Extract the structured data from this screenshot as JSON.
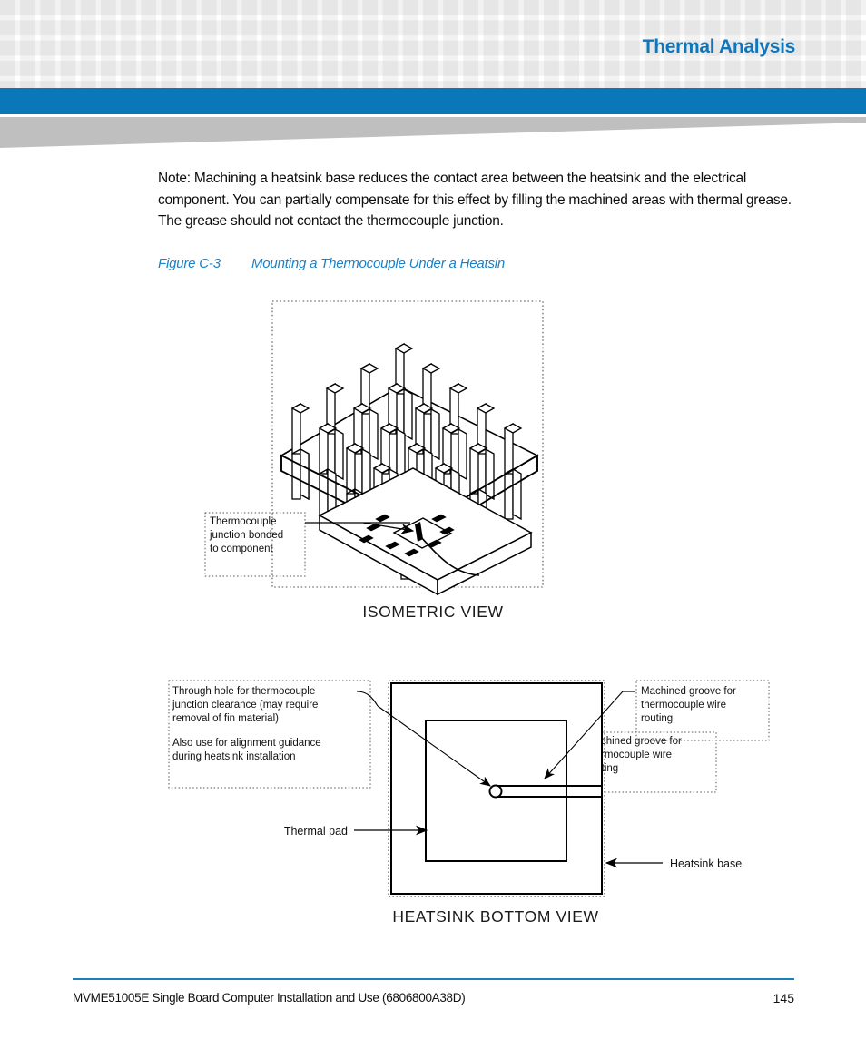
{
  "header": {
    "title": "Thermal Analysis",
    "accent_color": "#0a78b8",
    "title_color": "#0e76bc",
    "grid_color": "#f2f2f2",
    "swoosh_color": "#bfbfbf"
  },
  "body": {
    "note": "Note: Machining a heatsink base reduces the contact area between the heatsink and the electrical component. You can partially compensate for this effect by filling the machined areas with thermal grease. The grease should not contact the thermocouple junction."
  },
  "figure": {
    "number": "Figure C-3",
    "title": "Mounting a Thermocouple Under a Heatsin",
    "caption_color": "#1b80c4",
    "isometric": {
      "view_label": "ISOMETRIC VIEW",
      "callouts": [
        {
          "id": "thermocouple-junction",
          "lines": [
            "Thermocouple",
            "junction bonded",
            "to component"
          ]
        },
        {
          "id": "machined-groove",
          "lines": [
            "Machined groove for",
            "thermocouple wire",
            "routing"
          ]
        }
      ]
    },
    "bottom": {
      "view_label": "HEATSINK BOTTOM VIEW",
      "callouts": [
        {
          "id": "through-hole",
          "paragraph_1": [
            "Through hole for thermocouple",
            "junction clearance (may require",
            "removal of fin material)"
          ],
          "paragraph_2": [
            "Also use for alignment guidance",
            "during heatsink installation"
          ]
        },
        {
          "id": "machined-groove",
          "lines": [
            "Machined groove for",
            "thermocouple wire",
            "routing"
          ]
        }
      ],
      "labels": {
        "thermal_pad": "Thermal pad",
        "heatsink_base": "Heatsink base"
      }
    }
  },
  "footer": {
    "document": "MVME51005E Single Board Computer Installation and Use (6806800A38D)",
    "page_number": "145",
    "rule_color": "#1b7fbd"
  }
}
